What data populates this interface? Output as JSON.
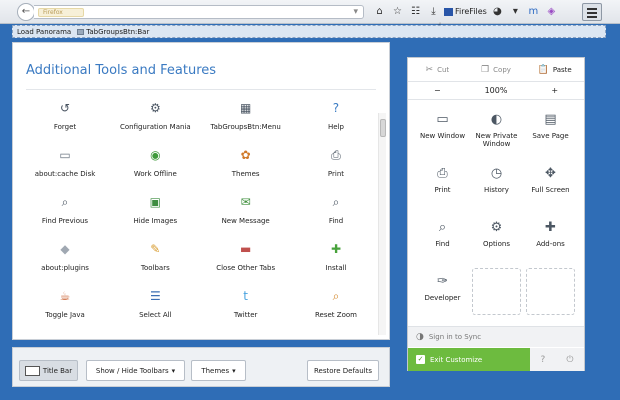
{
  "toolbar": {
    "back_icon": "back-arrow-icon",
    "url_identity": "Firefox",
    "firefiles_label": "FireFiles",
    "icons": [
      "home-icon",
      "star-icon",
      "list-icon",
      "download-icon"
    ]
  },
  "bookmarks": {
    "items": [
      {
        "label": "Load Panorama"
      },
      {
        "label": "TabGroupsBtn:Bar"
      }
    ]
  },
  "palette": {
    "title": "Additional Tools and Features",
    "tools": [
      {
        "label": "Forget",
        "icon": "↺",
        "color": "#4a5562"
      },
      {
        "label": "Configuration Mania",
        "icon": "⚙",
        "color": "#4a5562"
      },
      {
        "label": "TabGroupsBtn:Menu",
        "icon": "▦",
        "color": "#4a5562"
      },
      {
        "label": "Help",
        "icon": "?",
        "color": "#3c7dc4"
      },
      {
        "label": "about:cache Disk",
        "icon": "▭",
        "color": "#6d7783"
      },
      {
        "label": "Work Offline",
        "icon": "◉",
        "color": "#3f9a3b"
      },
      {
        "label": "Themes",
        "icon": "✿",
        "color": "#d07a2a"
      },
      {
        "label": "Print",
        "icon": "⎙",
        "color": "#4a5562"
      },
      {
        "label": "Find Previous",
        "icon": "⌕",
        "color": "#4a5562"
      },
      {
        "label": "Hide Images",
        "icon": "▣",
        "color": "#3e8d41"
      },
      {
        "label": "New Message",
        "icon": "✉",
        "color": "#3f8f3c"
      },
      {
        "label": "Find",
        "icon": "⌕",
        "color": "#4a5562"
      },
      {
        "label": "about:plugins",
        "icon": "◆",
        "color": "#a0a8b2"
      },
      {
        "label": "Toolbars",
        "icon": "✎",
        "color": "#d79a2c"
      },
      {
        "label": "Close Other Tabs",
        "icon": "▬",
        "color": "#c0504d"
      },
      {
        "label": "Install",
        "icon": "✚",
        "color": "#47a23b"
      },
      {
        "label": "Toggle Java",
        "icon": "☕",
        "color": "#c75a2a"
      },
      {
        "label": "Select All",
        "icon": "☰",
        "color": "#3d6fb3"
      },
      {
        "label": "Twitter",
        "icon": "t",
        "color": "#4aa3df"
      },
      {
        "label": "Reset Zoom",
        "icon": "⌕",
        "color": "#d2872a"
      }
    ]
  },
  "bottom": {
    "title_bar": "Title Bar",
    "show_hide": "Show / Hide Toolbars",
    "themes": "Themes",
    "restore": "Restore Defaults"
  },
  "menu": {
    "cut": "Cut",
    "copy": "Copy",
    "paste": "Paste",
    "zoom_out": "−",
    "zoom_level": "100%",
    "zoom_in": "+",
    "items": [
      {
        "label": "New Window",
        "icon": "▭"
      },
      {
        "label": "New Private Window",
        "icon": "◐"
      },
      {
        "label": "Save Page",
        "icon": "▤"
      },
      {
        "label": "Print",
        "icon": "⎙"
      },
      {
        "label": "History",
        "icon": "◷"
      },
      {
        "label": "Full Screen",
        "icon": "✥"
      },
      {
        "label": "Find",
        "icon": "⌕"
      },
      {
        "label": "Options",
        "icon": "⚙"
      },
      {
        "label": "Add-ons",
        "icon": "✚"
      },
      {
        "label": "Developer",
        "icon": "✑"
      }
    ],
    "sync": "Sign in to Sync",
    "exit": "Exit Customize"
  },
  "colors": {
    "accent_title": "#3a7ac2",
    "exit_green": "#6dbb3f",
    "background_blue": "#2f6db6"
  }
}
